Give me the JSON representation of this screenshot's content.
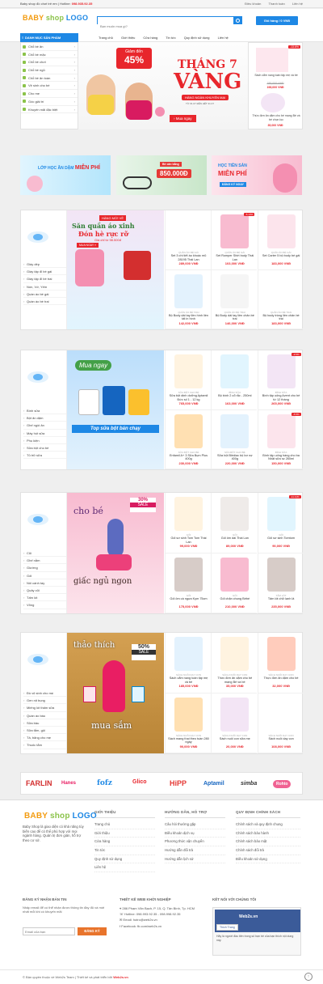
{
  "topbar": {
    "text": "Baby shop đồ chơi trẻ em",
    "hotline_label": "Hotline:",
    "hotline": "098.935.92.35",
    "links": [
      "Điều khoản",
      "Thanh toán",
      "Liên hệ"
    ]
  },
  "header": {
    "logo_1": "BABY",
    "logo_2": "shop",
    "logo_3": "LOGO",
    "search_placeholder": "Bạn muốn mua gì?",
    "cart": "Giỏ hàng / 0 VNĐ"
  },
  "nav": {
    "category_title": "DANH MỤC SẢN PHẨM",
    "menu": [
      "Trang chủ",
      "Giới thiệu",
      "Cửa hàng",
      "Tin tức",
      "Quy định sử dụng",
      "Liên hệ"
    ]
  },
  "sidebar": [
    "Chỗ bé ăn",
    "Chỗ bé mặc",
    "Chỗ bé chơi",
    "Chỗ bé ngủ",
    "Chỗ bé ăn toàn",
    "Vệ sinh cho bé",
    "Cho mẹ",
    "Góc giải trí",
    "Khuyến mãi đặc biệt"
  ],
  "hero": {
    "sale_1": "Giảm đến",
    "sale_2": "45%",
    "title_1": "THÁNG 7",
    "title_2": "VÀNG",
    "sub": "HÀNG NGÀN KHUYẾN MẠI",
    "date": "TỪ 01.07 ĐẾN HẾT 31.07",
    "cta": "› Mua ngay"
  },
  "right_ad": [
    {
      "badge": "-13.6%",
      "name": "Sách cẩm nang toàn tập mẹ và bé",
      "old": "185,000 VNĐ",
      "price": "198,000 VNĐ"
    },
    {
      "name": "Thức đơn ăn dặm cho bé mạng Bé và bé chọn lọc",
      "price": "35,000 VNĐ"
    }
  ],
  "banners": [
    {
      "title": "LỚP HỌC ĂN DẶM",
      "highlight": "MIỄN PHÍ"
    },
    {
      "top": "Bé cân bằng",
      "value": "850.000Đ"
    },
    {
      "title": "HỌC TIỀN SẢN",
      "highlight": "MIỄN PHÍ",
      "cta": "ĐĂNG KÝ NGAY"
    }
  ],
  "sections": [
    {
      "categories": [
        "Giày dép",
        "Giày tập đi bé gái",
        "Giày tập đi bé trai",
        "Nón, Vớ, Yếm",
        "Quần áo bé gái",
        "Quần áo bé trai"
      ],
      "banner": {
        "top": "HÀNG MỚI VỀ",
        "l1": "Săn quần áo xinh",
        "l2": "Đón hè rực rỡ",
        "l3": "Giá chỉ từ 98.500đ",
        "cta": "MUA NGAY »"
      },
      "products": [
        {
          "cat": "QUẦN ÁO BÉ GÁI",
          "name": "Set 3 chi tiết áo khoác mũ 28195 Thái Lan",
          "price": "289,000 VNĐ"
        },
        {
          "cat": "QUẦN ÁO BÉ GÁI",
          "name": "Set Romper Shirt body Thái Lan",
          "price": "103,000 VNĐ",
          "badge": "-5.13%"
        },
        {
          "cat": "QUẦN ÁO BÉ GÁI",
          "name": "Set Carter 5 bộ body bé gái",
          "price": "183,000 VNĐ"
        },
        {
          "cat": "QUẦN ÁO BÉ TRAI",
          "name": "Bộ Body dài tay liền hình liền tất in hình",
          "price": "142,000 VNĐ"
        },
        {
          "cat": "QUẦN ÁO BÉ TRAI",
          "name": "Bộ Body dài tay liền chân bé trai",
          "price": "146,000 VNĐ"
        },
        {
          "cat": "QUẦN ÁO BÉ TRAI",
          "name": "Bộ body tròng liền chân bé trai",
          "price": "183,000 VNĐ"
        }
      ]
    },
    {
      "categories": [
        "Bình sữa",
        "Bột ăn dặm",
        "Ghế ngồi ăn",
        "Máy hút sữa",
        "Phụ kiện",
        "Sữa bột cho bé",
        "Tủ trữ sữa"
      ],
      "banner": {
        "top": "Mua ngay",
        "l1": "Top sữa bột bán chạy"
      },
      "products": [
        {
          "cat": "SỮA BỘT CHO BÉ",
          "name": "Sữa bột dinh dưỡng Aptamil Đức số 1 - 12 kg",
          "price": "765,000 VNĐ"
        },
        {
          "cat": "BÌNH SỮA",
          "name": "Bộ bình 2 cổ rắc - 250ml",
          "price": "163,000 VNĐ"
        },
        {
          "cat": "BÌNH SỮA",
          "name": "Bình tập uống Avent cho bé từ 12 tháng",
          "price": "265,000 VNĐ",
          "badge": "-3.5%"
        },
        {
          "cat": "SỮA BỘT CHO BÉ",
          "name": "Enfamil A+ 3 Sữa Bụm Plus 400g",
          "price": "230,000 VNĐ"
        },
        {
          "cat": "SỮA BỘT CHO BÉ",
          "name": "Sữa bột Blédiac bộ bơ nợ 400g",
          "price": "220,000 VNĐ"
        },
        {
          "cat": "BÌNH SỮA",
          "name": "Bình tập uống hàng cho ba Nhật sữa sz 260ml",
          "price": "150,000 VNĐ",
          "badge": "-5.5%"
        }
      ]
    },
    {
      "categories": [
        "Cũi",
        "Ghế nằm",
        "Giường",
        "Gối",
        "Nôi cánh tay",
        "Quây cũi",
        "Tấm lót",
        "Võng"
      ],
      "banner": {
        "l1": "cho bé",
        "l2": "giấc ngủ ngon",
        "sale_1": "30%",
        "sale_2": "SALE"
      },
      "products": [
        {
          "cat": "GỐI",
          "name": "Gối sơ sinh Tom Tom Thái Lan",
          "price": "99,000 VNĐ"
        },
        {
          "cat": "GỐI",
          "name": "Gối ôm dài Thái Lan",
          "price": "89,000 VNĐ"
        },
        {
          "cat": "GỐI",
          "name": "Gối sơ sinh Tomtom",
          "price": "90,000 VNĐ",
          "badge": "-11.11%"
        },
        {
          "cat": "GỐI",
          "name": "Gối ôm cà ngựa Kym 75cm",
          "price": "175,000 VNĐ"
        },
        {
          "cat": "GỐI",
          "name": "Gối chặn chung Bébé",
          "price": "210,000 VNĐ"
        },
        {
          "cat": "TẤM LÓT",
          "name": "Tấm lót chữ lạnh lâ",
          "price": "235,000 VNĐ"
        }
      ]
    },
    {
      "categories": [
        "Đồ vệ sinh cho mẹ",
        "Gen nịt bụng",
        "Miếng lót thấm sữa",
        "Quần áo bầu",
        "Sữa bầu",
        "Sữa tắm, gội",
        "Tả, băng cho mẹ",
        "Thuốc tắm"
      ],
      "banner": {
        "l1": "thảo thích",
        "l2": "mua sắm",
        "sale_1": "50%",
        "sale_2": "SALE"
      },
      "products": [
        {
          "cat": "SÁCH NUÔI DẠY CON",
          "name": "Sách cẩm nang toàn tập mẹ và bé",
          "price": "185,000 VNĐ"
        },
        {
          "cat": "SÁCH NUÔI DẠY CON",
          "name": "Thức đơn ăn dặm cho bé mạng Bé và bé",
          "price": "35,000 VNĐ"
        },
        {
          "cat": "SÁCH NUÔI DẠY CON",
          "name": "Thực đơn ăn dặm cho bé",
          "price": "32,000 VNĐ"
        },
        {
          "cat": "SÁCH NUÔI DẠY CON",
          "name": "Sách mang thai theo tuần 280 ngày",
          "price": "90,000 VNĐ"
        },
        {
          "cat": "SÁCH NUÔI DẠY CON",
          "name": "Sách nuôi con sữa mẹ",
          "price": "20,000 VNĐ"
        },
        {
          "cat": "SÁCH NUÔI DẠY CON",
          "name": "Sách nuôi dạy con",
          "price": "108,000 VNĐ"
        }
      ]
    }
  ],
  "brands": [
    "FARLIN",
    "Hanes",
    "fofz",
    "Glico",
    "HiPP",
    "Aptamil",
    "simba",
    "Rohto"
  ],
  "footer": {
    "about": "Baby Shop là giao diện có khả năng tùy biến cao để có thể phù hợp với mọi ngành hàng. Quản trị đơn giản, hỗ trợ theo cơ sở.",
    "col1": {
      "title": "GIỚI THIỆU",
      "items": [
        "Trang chủ",
        "Giới thiệu",
        "Cửa hàng",
        "Tin tức",
        "Quy định sử dụng",
        "Liên hệ"
      ]
    },
    "col2": {
      "title": "HƯỚNG DẪN, HỖ TRỢ",
      "items": [
        "Câu hỏi thường gặp",
        "Điều khoản dịch vụ",
        "Phương thức vận chuyển",
        "Hướng dẫn đổi trả",
        "Hướng dẫn lịch sử"
      ]
    },
    "col3": {
      "title": "QUY ĐỊNH CHÍNH SÁCH",
      "items": [
        "Chính sách và quy định chung",
        "Chính sách bảo hành",
        "Chính sách bảo mật",
        "Chính sách đổi trả",
        "Điều khoản sử dụng"
      ]
    },
    "subscribe": {
      "title": "ĐĂNG KÝ NHẬN BẢN TIN",
      "text": "Nhập email để có thể nhận được thông tin đầy đủ và mới nhất mỗi khi có khuyến mãi",
      "placeholder": "Email của bạn",
      "button": "ĐĂNG KÝ"
    },
    "contact": {
      "title": "THIẾT KẾ WEB KHỞI NGHIỆP",
      "lines": [
        "286 Phạm Văn Bạch, P. 15, Q. Tân Bình, Tp. HCM",
        "Hotline: 098.993.92.35 - 098.998.92.35",
        "Email: hotro@web2s.vn",
        "Facebook: fb.com/web2s.vn"
      ]
    },
    "social": {
      "title": "KẾT NỐI VỚI CHÚNG TÔI",
      "page": "Web2s.vn",
      "like": "Thích Trang",
      "note": "Hãy là người đầu tiên trong số bạn bè của bạn thích nội dung này."
    }
  },
  "copyright": {
    "text": "© Bản quyền thuộc về Web2s Team | Thiết kế và phát triển bởi",
    "brand": "Web2s.vn"
  }
}
